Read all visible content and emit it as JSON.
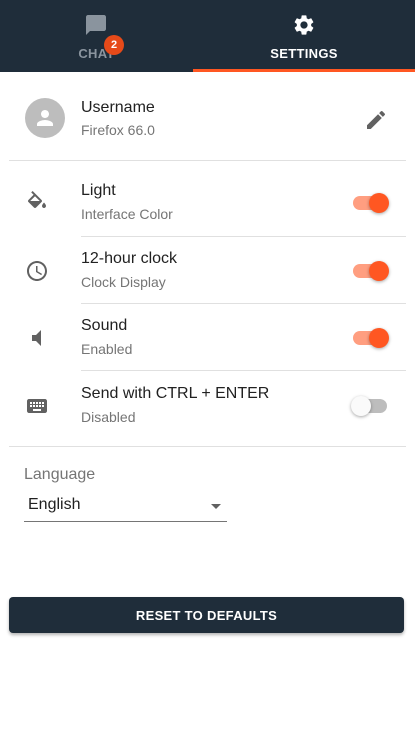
{
  "tabs": [
    {
      "label": "CHAT",
      "icon": "chat-bubble-icon",
      "badge": "2",
      "active": false
    },
    {
      "label": "SETTINGS",
      "icon": "gear-icon",
      "active": true
    }
  ],
  "profile": {
    "name": "Username",
    "browser": "Firefox 66.0",
    "avatar_icon": "person-icon",
    "edit_icon": "pencil-icon"
  },
  "settings": [
    {
      "title": "Light",
      "subtitle": "Interface Color",
      "icon": "paint-bucket-icon",
      "enabled": true
    },
    {
      "title": "12-hour clock",
      "subtitle": "Clock Display",
      "icon": "clock-icon",
      "enabled": true
    },
    {
      "title": "Sound",
      "subtitle": "Enabled",
      "icon": "speaker-icon",
      "enabled": true
    },
    {
      "title": "Send with CTRL + ENTER",
      "subtitle": "Disabled",
      "icon": "keyboard-icon",
      "enabled": false
    }
  ],
  "language": {
    "label": "Language",
    "value": "English"
  },
  "reset_label": "RESET TO DEFAULTS",
  "colors": {
    "header_bg": "#1f2d3a",
    "accent": "#ff5722",
    "accent_track": "#ff9e80",
    "badge": "#e64a19"
  }
}
